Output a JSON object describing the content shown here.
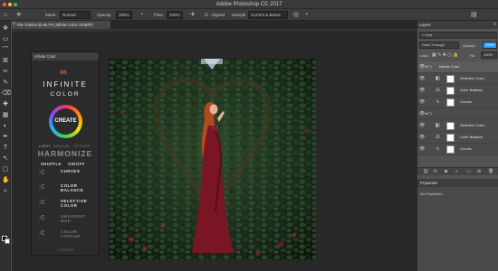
{
  "window": {
    "title": "Adobe Photoshop CC 2017"
  },
  "options_bar": {
    "mode_label": "Mode:",
    "mode_value": "Normal",
    "opacity_label": "Opacity:",
    "opacity_value": "100%",
    "flow_label": "Flow:",
    "flow_value": "100%",
    "align_label": "Aligned",
    "sample_label": "Sample:",
    "sample_value": "Current & Below"
  },
  "document_tab": {
    "label": "File Tutorial @ 66.7% (Infinite Color, RGB/8*)",
    "close": "×"
  },
  "tools": [
    "✥",
    "▭",
    "⌒",
    "⌘",
    "✂",
    "✎",
    "⌫",
    "✚",
    "▦",
    "◐",
    "✒",
    "T",
    "↖",
    "▢",
    "✋",
    "⌕"
  ],
  "infinite_color_panel": {
    "header": "Infinite Color",
    "brand_top": "INFINITE",
    "brand_bottom": "COLOR",
    "create_label": "CREATE",
    "modes": [
      "LIGHT",
      "MEDIUM",
      "INTENSE"
    ],
    "harmonize_label": "HARMONIZE",
    "shuffle_label": "SHUFFLE",
    "onoff_label": "ON/OFF",
    "rows": [
      {
        "icon": "⤮",
        "line1": "CURVES",
        "line2": ""
      },
      {
        "icon": "⤮",
        "line1": "COLOR",
        "line2": "BALANCE"
      },
      {
        "icon": "⤮",
        "line1": "SELECTIVE",
        "line2": "COLOR"
      },
      {
        "icon": "⤮",
        "line1": "GRADIENT",
        "line2": "MAP"
      },
      {
        "icon": "⤮",
        "line1": "COLOR",
        "line2": "LOOKUP"
      }
    ],
    "footer": "© INFINITE"
  },
  "layers_panel": {
    "tab_label": "Layers",
    "kind_label": "Kind",
    "blend_mode": "Pass Through",
    "opacity_label": "Opacity:",
    "opacity_value": "100%",
    "lock_label": "Lock:",
    "fill_label": "Fill:",
    "fill_value": "100%",
    "layers": [
      {
        "name": "Infinite Color",
        "type": "group",
        "selected": true
      },
      {
        "name": "Selective Color",
        "type": "adjustment"
      },
      {
        "name": "Color Balance",
        "type": "adjustment"
      },
      {
        "name": "Curves",
        "type": "adjustment"
      },
      {
        "name": "",
        "type": "group"
      },
      {
        "name": "Selective Color",
        "type": "adjustment"
      },
      {
        "name": "Color Balance",
        "type": "adjustment"
      },
      {
        "name": "Curves",
        "type": "adjustment"
      }
    ]
  },
  "properties_panel": {
    "tab_label": "Properties",
    "empty_label": "No Properties"
  },
  "colors": {
    "ui_dark": "#282828",
    "panel_bg": "#2b2b2b",
    "ivy_green": "#1f3a20",
    "dress_red": "#7a1524",
    "accent_blue": "#1f9cff"
  }
}
